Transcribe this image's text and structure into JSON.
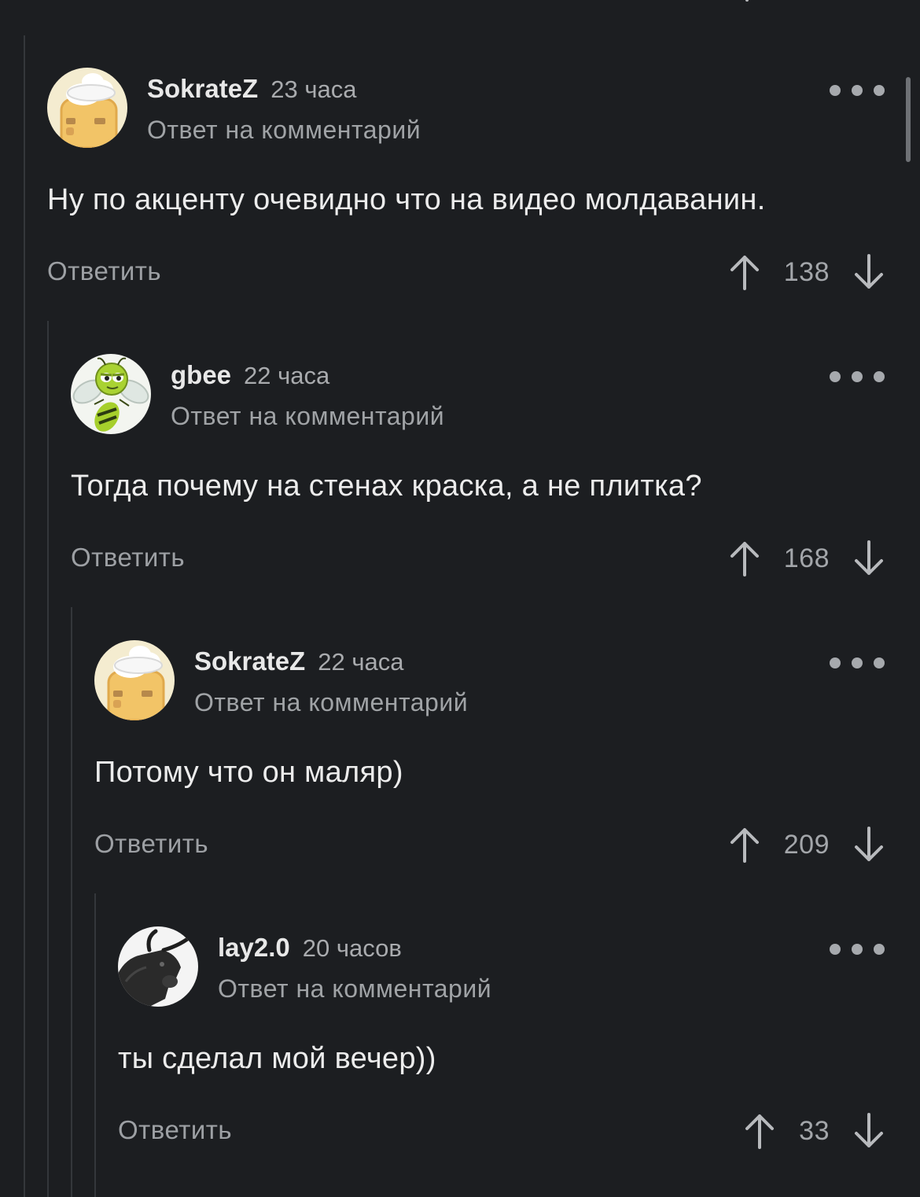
{
  "comments": [
    {
      "username": "SokrateZ",
      "time": "23 часа",
      "reply_to": "Ответ на комментарий",
      "text": "Ну по акценту очевидно что на видео молдаванин.",
      "reply_label": "Ответить",
      "score": "138",
      "avatar_icon": "chef-toast-avatar"
    },
    {
      "username": "gbee",
      "time": "22 часа",
      "reply_to": "Ответ на комментарий",
      "text": "Тогда почему на стенах краска, а не плитка?",
      "reply_label": "Ответить",
      "score": "168",
      "avatar_icon": "bee-avatar"
    },
    {
      "username": "SokrateZ",
      "time": "22 часа",
      "reply_to": "Ответ на комментарий",
      "text": "Потому что он маляр)",
      "reply_label": "Ответить",
      "score": "209",
      "avatar_icon": "chef-toast-avatar"
    },
    {
      "username": "lay2.0",
      "time": "20 часов",
      "reply_to": "Ответ на комментарий",
      "text": "ты сделал мой вечер))",
      "reply_label": "Ответить",
      "score": "33",
      "avatar_icon": "bull-avatar"
    }
  ],
  "colors": {
    "background": "#1c1e21",
    "thread_line": "#34373b",
    "text_primary": "#ececec",
    "text_secondary": "#a0a3a6"
  }
}
